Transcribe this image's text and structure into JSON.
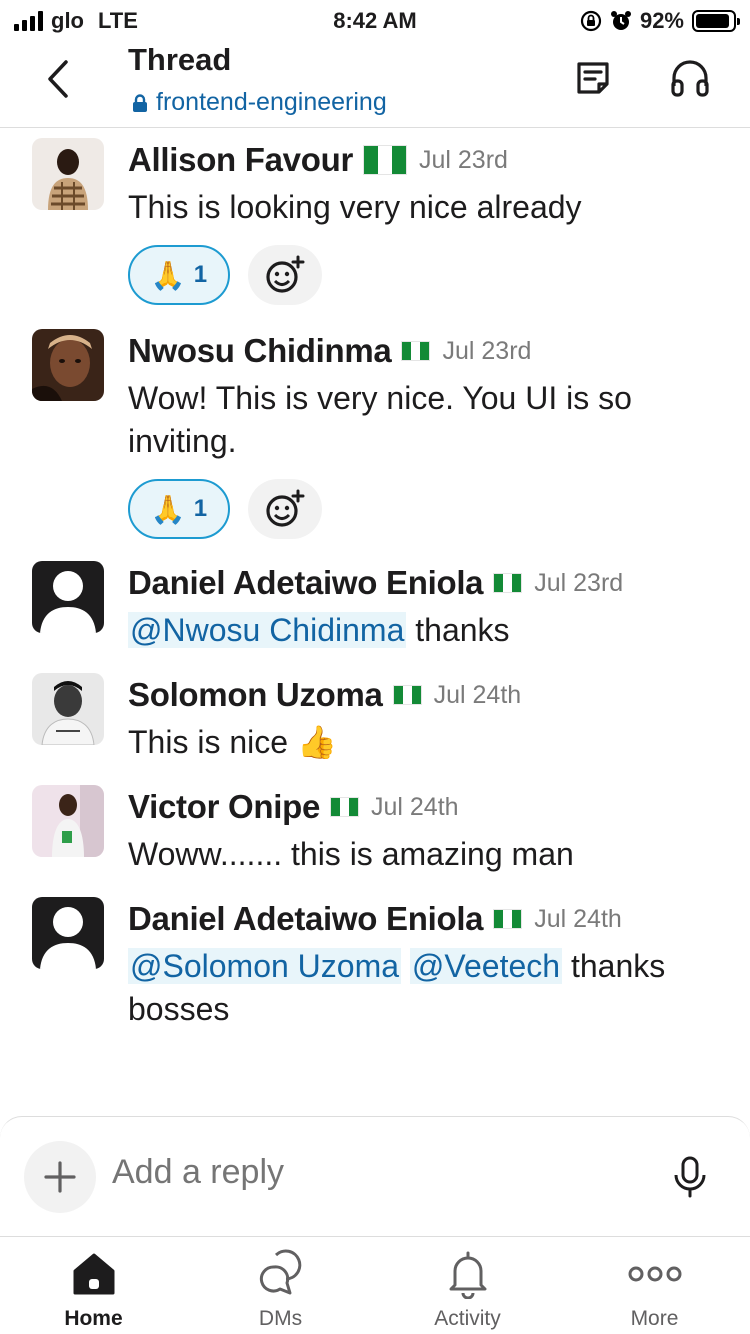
{
  "status_bar": {
    "carrier": "glo",
    "network": "LTE",
    "time": "8:42 AM",
    "battery": "92%",
    "battery_level": 0.92
  },
  "header": {
    "title": "Thread",
    "channel": "frontend-engineering"
  },
  "messages": [
    {
      "author": "Allison Favour",
      "date": "Jul 23rd",
      "text": "This is looking very nice already",
      "reaction": {
        "emoji": "🙏",
        "count": "1"
      }
    },
    {
      "author": "Nwosu Chidinma",
      "date": "Jul 23rd",
      "text": "Wow! This is very nice. You UI is so inviting.",
      "reaction": {
        "emoji": "🙏",
        "count": "1"
      }
    },
    {
      "author": "Daniel Adetaiwo Eniola",
      "date": "Jul 23rd",
      "mention": "@Nwosu Chidinma",
      "text": " thanks"
    },
    {
      "author": "Solomon Uzoma",
      "date": "Jul 24th",
      "text": "This is nice ",
      "emoji": "👍"
    },
    {
      "author": "Victor Onipe",
      "date": "Jul 24th",
      "text": "Woww....... this is amazing man"
    },
    {
      "author": "Daniel Adetaiwo Eniola",
      "date": "Jul 24th",
      "mention1": "@Solomon Uzoma",
      "mention2": "@Veetech",
      "text": " thanks bosses"
    }
  ],
  "reply": {
    "placeholder": "Add a reply"
  },
  "tabs": [
    {
      "label": "Home",
      "icon": "home-icon",
      "active": true
    },
    {
      "label": "DMs",
      "icon": "dms-icon"
    },
    {
      "label": "Activity",
      "icon": "bell-icon"
    },
    {
      "label": "More",
      "icon": "more-icon"
    }
  ],
  "colors": {
    "link": "#1264a3",
    "mention_bg": "#e8f5fa",
    "reaction_border": "#1d9bd1",
    "flag_green": "#138a36"
  }
}
